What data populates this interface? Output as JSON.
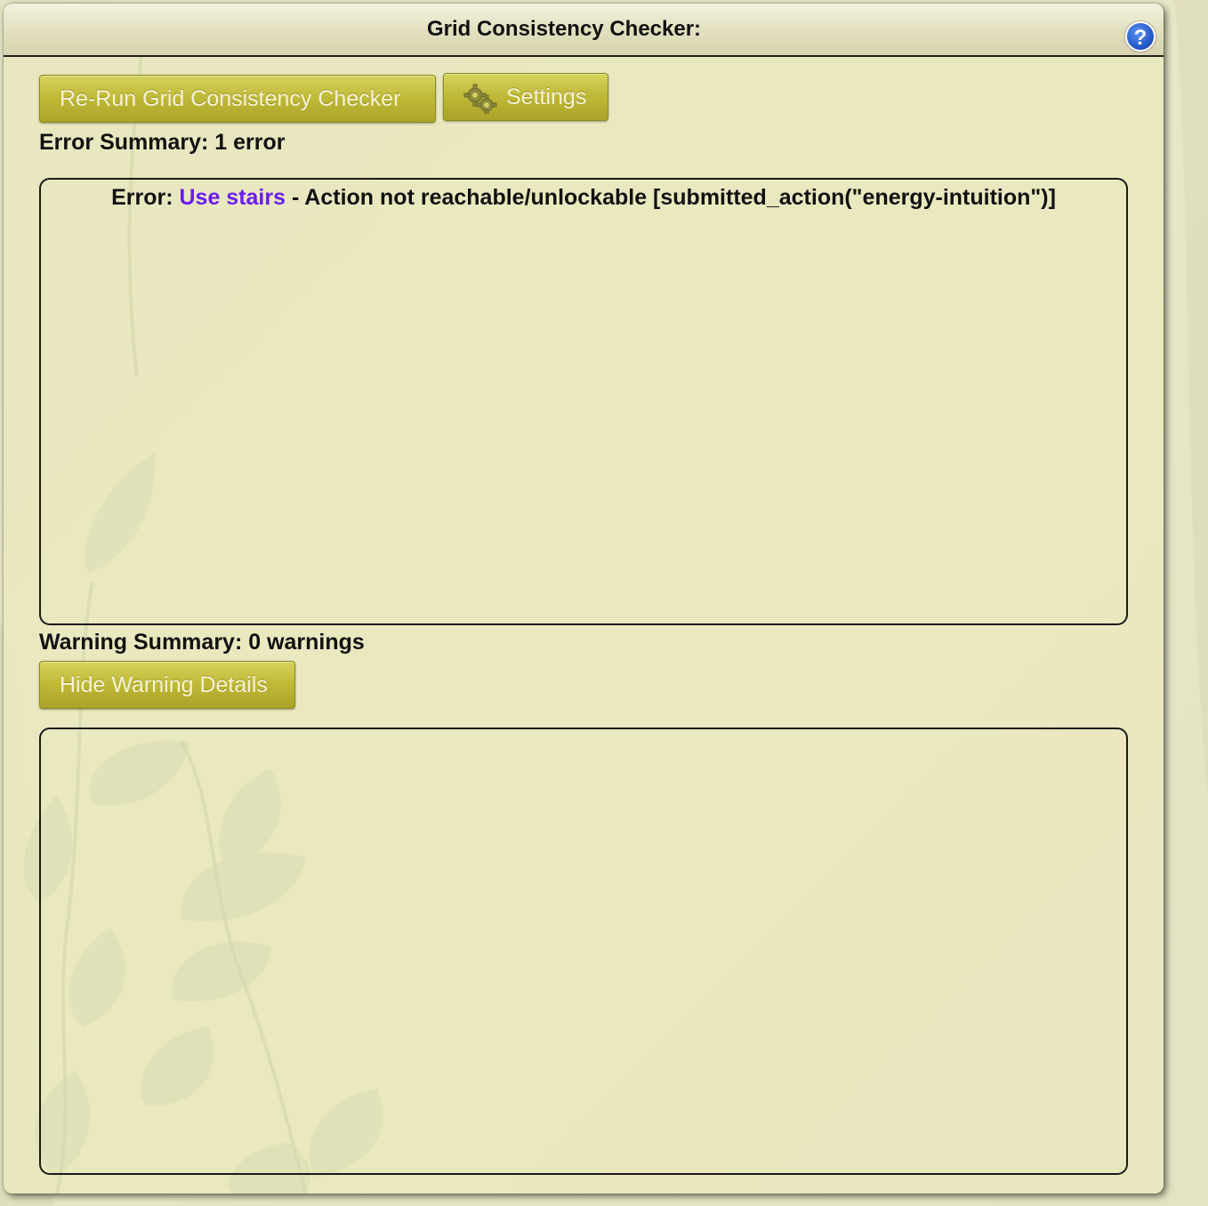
{
  "dialog": {
    "title": "Grid Consistency Checker:",
    "help_label": "?"
  },
  "toolbar": {
    "rerun_label": "Re-Run Grid Consistency Checker",
    "settings_label": "Settings"
  },
  "errors": {
    "summary": "Error Summary: 1 error",
    "items": [
      {
        "prefix": "Error:",
        "link_text": "Use stairs",
        "message": "- Action not reachable/unlockable [submitted_action(\"energy-intuition\")]"
      }
    ]
  },
  "warnings": {
    "summary": "Warning Summary: 0 warnings",
    "toggle_label": "Hide Warning Details",
    "items": []
  },
  "colors": {
    "accent_button": "#bfb937",
    "link": "#6a1cf0",
    "panel_background": "#eae7be",
    "help_button": "#2a5fd0"
  },
  "icons": {
    "help": "question-mark-circle-icon",
    "settings": "gears-icon"
  }
}
